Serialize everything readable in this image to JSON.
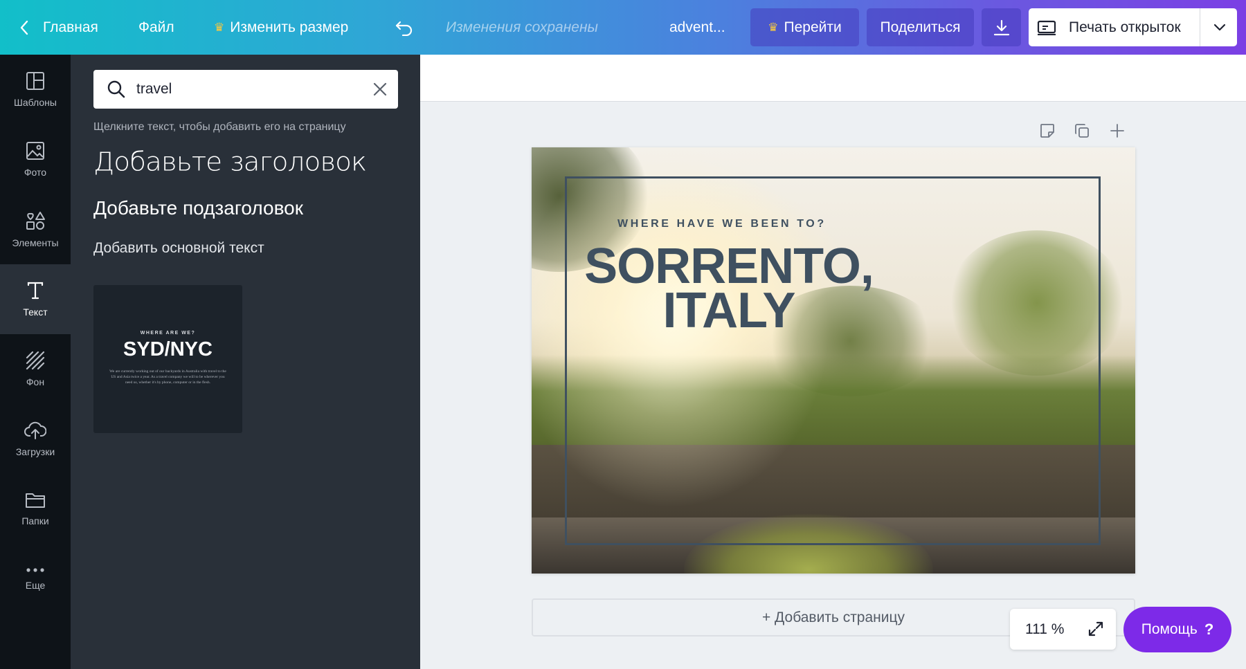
{
  "topbar": {
    "home_label": "Главная",
    "file_label": "Файл",
    "resize_label": "Изменить размер",
    "saved_status": "Изменения сохранены",
    "doc_title": "advent...",
    "go_label": "Перейти",
    "share_label": "Поделиться",
    "print_label": "Печать открыток"
  },
  "rail": {
    "items": [
      {
        "label": "Шаблоны",
        "icon": "templates-icon"
      },
      {
        "label": "Фото",
        "icon": "photo-icon"
      },
      {
        "label": "Элементы",
        "icon": "elements-icon"
      },
      {
        "label": "Текст",
        "icon": "text-icon"
      },
      {
        "label": "Фон",
        "icon": "background-icon"
      },
      {
        "label": "Загрузки",
        "icon": "upload-icon"
      },
      {
        "label": "Папки",
        "icon": "folder-icon"
      },
      {
        "label": "Еще",
        "icon": "more-icon"
      }
    ],
    "active": "Текст"
  },
  "panel": {
    "search_value": "travel",
    "hint": "Щелкните текст, чтобы добавить его на страницу",
    "add_heading": "Добавьте заголовок",
    "add_subheading": "Добавьте подзаголовок",
    "add_body": "Добавить основной текст",
    "template_card": {
      "small": "WHERE ARE WE?",
      "big": "SYD/NYC",
      "para": "We are currently working out of our backyards in Australia with travel to the US and Asia twice a year. As a travel company we will to be wherever you need us, whether it's by phone, computer or in the flesh."
    }
  },
  "canvas": {
    "card_tagline": "WHERE HAVE WE BEEN TO?",
    "card_title": "SORRENTO,\nITALY",
    "add_page_label": "+ Добавить страницу",
    "zoom": "111 %",
    "help_label": "Помощь",
    "help_q": "?"
  },
  "colors": {
    "accent_purple": "#7d2ae8",
    "panel_bg": "#293039",
    "rail_bg": "#0e1318",
    "card_text": "#3f5060"
  }
}
